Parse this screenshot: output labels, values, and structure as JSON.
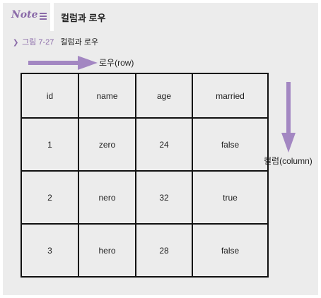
{
  "note": {
    "logo_text": "Note",
    "title": "컬럼과 로우"
  },
  "figure": {
    "number": "그림 7-27",
    "title": "컬럼과 로우"
  },
  "labels": {
    "row": "로우(row)",
    "column": "컬럼(column)"
  },
  "colors": {
    "accent": "#8a6aa8",
    "arrow": "#a387c2",
    "panel": "#ececec",
    "border": "#111111"
  },
  "table": {
    "headers": [
      "id",
      "name",
      "age",
      "married"
    ],
    "rows": [
      [
        "1",
        "zero",
        "24",
        "false"
      ],
      [
        "2",
        "nero",
        "32",
        "true"
      ],
      [
        "3",
        "hero",
        "28",
        "false"
      ]
    ]
  }
}
